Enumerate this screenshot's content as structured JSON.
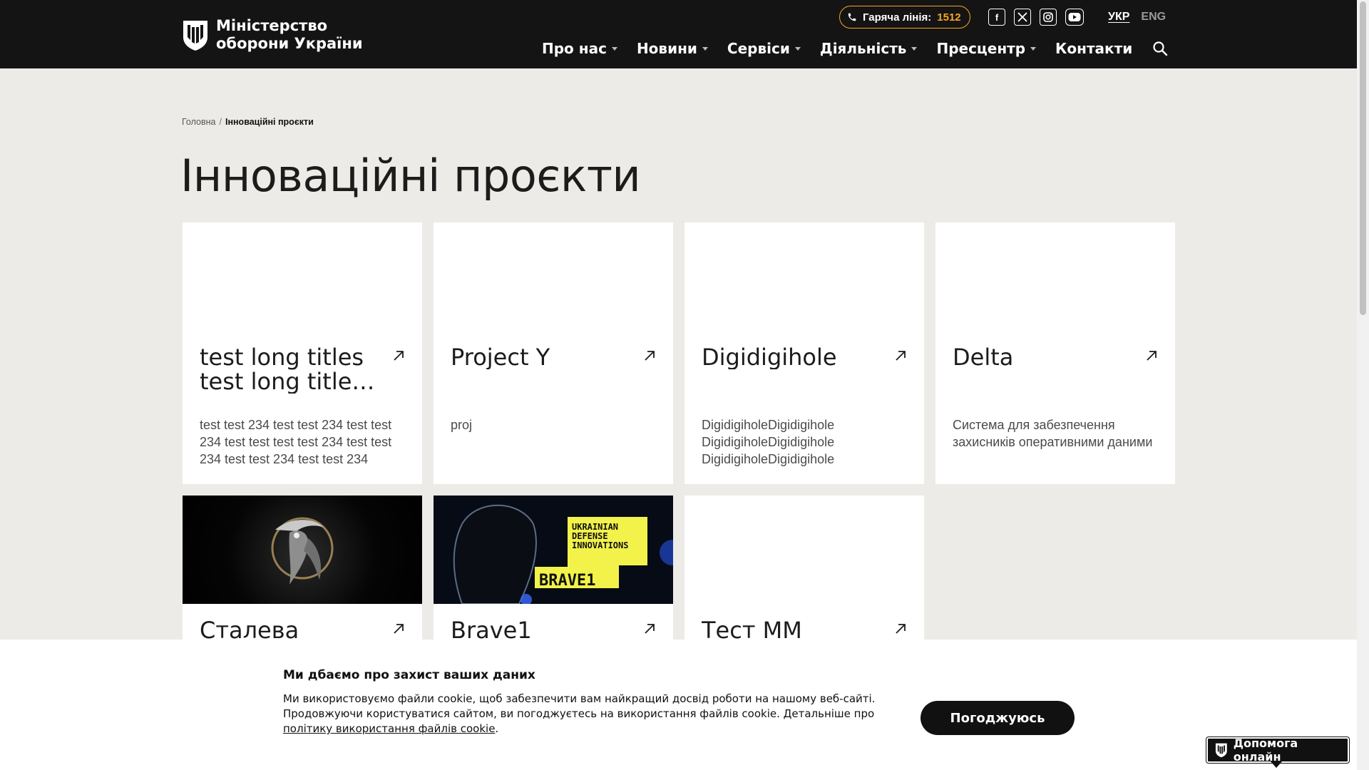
{
  "header": {
    "logo_line1": "Міністерство",
    "logo_line2": "оборони України",
    "hotline_label": "Гаряча лінія:",
    "hotline_number": "1512",
    "socials": [
      "facebook-icon",
      "x-icon",
      "instagram-icon",
      "youtube-icon"
    ],
    "lang_active": "УКР",
    "lang_other": "ENG",
    "nav": [
      {
        "label": "Про нас",
        "dropdown": true
      },
      {
        "label": "Новини",
        "dropdown": true
      },
      {
        "label": "Сервіси",
        "dropdown": true
      },
      {
        "label": "Діяльність",
        "dropdown": true
      },
      {
        "label": "Пресцентр",
        "dropdown": true
      },
      {
        "label": "Контакти",
        "dropdown": false
      }
    ]
  },
  "breadcrumb": {
    "home": "Головна",
    "separator": "/",
    "current": "Інноваційні проєкти"
  },
  "page_title": "Інноваційні проєкти",
  "cards": [
    {
      "title": "test long titles test long titles test long titles",
      "description": "test test 234 test test 234 test test 234 test test test test 234 test test 234 test test 234 test test 234",
      "image": null
    },
    {
      "title": "Project Y",
      "description": "proj",
      "image": null
    },
    {
      "title": "Digidigihole",
      "description": "DigidigiholeDigidigihole DigidigiholeDigidigihole DigidigiholeDigidigihole",
      "image": null
    },
    {
      "title": "Delta",
      "description": "Система для забезпечення захисників оперативними даними",
      "image": null
    },
    {
      "title": "Сталева",
      "description": "",
      "image": "metal-bird-emblem"
    },
    {
      "title": "Brave1",
      "description": "",
      "image": "brave1-banner",
      "image_text": [
        "UKRAINIAN",
        "DEFENSE",
        "INNOVATIONS",
        "BRAVE1"
      ]
    },
    {
      "title": "Тест ММ",
      "description": "",
      "image": null
    }
  ],
  "cookie": {
    "title": "Ми дбаємо про захист ваших даних",
    "text": "Ми використовуємо файли cookie, щоб забезпечити вам найкращий досвід роботи на нашому веб-сайті. Продовжуючи користуватися сайтом, ви погоджуєтесь на використання файлів cookie. Детальніше про",
    "link": "політику використання файлів cookie",
    "after_link": ".",
    "accept": "Погоджуюсь"
  },
  "help_widget": "Допомога онлайн",
  "colors": {
    "header_bg": "#141414",
    "accent": "#f5a623",
    "page_bg": "#edebe7",
    "brave_yellow": "#f2f24a"
  }
}
